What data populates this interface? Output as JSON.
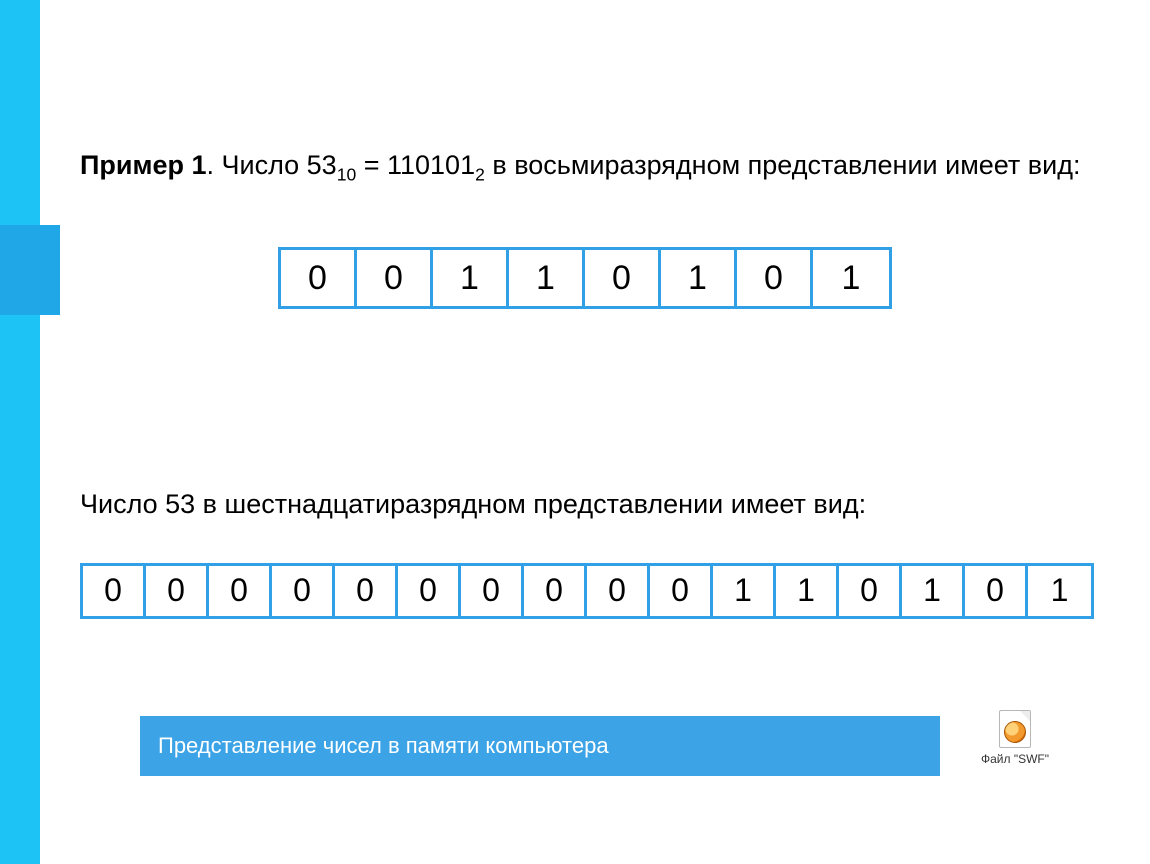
{
  "example": {
    "label": "Пример 1",
    "sentence_part1": ". Число 53",
    "sub1": "10",
    "sentence_part2": " = 110101",
    "sub2": "2",
    "sentence_part3": " в восьмиразрядном представлении имеет вид:"
  },
  "bits8": [
    "0",
    "0",
    "1",
    "1",
    "0",
    "1",
    "0",
    "1"
  ],
  "sentence2": "Число 53 в шестнадцатиразрядном представлении имеет вид:",
  "bits16": [
    "0",
    "0",
    "0",
    "0",
    "0",
    "0",
    "0",
    "0",
    "0",
    "0",
    "1",
    "1",
    "0",
    "1",
    "0",
    "1"
  ],
  "footer": {
    "title": "Представление чисел в памяти компьютера",
    "file_label": "Файл \"SWF\""
  }
}
